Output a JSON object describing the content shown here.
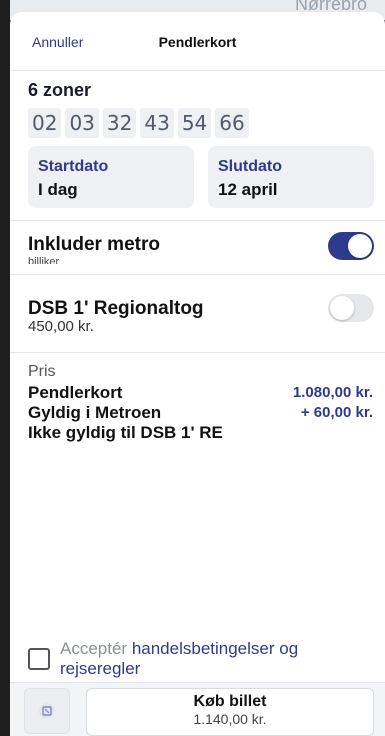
{
  "background": {
    "peek_text": "Nørrebro"
  },
  "header": {
    "cancel_label": "Annuller",
    "title": "Pendlerkort"
  },
  "zones": {
    "label": "6 zoner",
    "list": [
      "02",
      "03",
      "32",
      "43",
      "54",
      "66"
    ]
  },
  "dates": {
    "start_label": "Startdato",
    "start_value": "I dag",
    "end_label": "Slutdato",
    "end_value": "12 april"
  },
  "metro": {
    "label": "Inkluder metro",
    "sub": "billiker",
    "enabled": true
  },
  "dsb": {
    "label": "DSB 1' Regionaltog",
    "price": "450,00 kr.",
    "enabled": false
  },
  "pricing": {
    "title": "Pris",
    "rows": [
      {
        "label": "Pendlerkort",
        "amount": "1.080,00 kr."
      },
      {
        "label": "Gyldig i Metroen",
        "amount": "+ 60,00 kr."
      },
      {
        "label": "Ikke gyldig til DSB 1' RE",
        "amount": ""
      }
    ]
  },
  "terms": {
    "prefix": "Acceptér ",
    "link": "handelsbetingelser og rejseregler"
  },
  "buy": {
    "label": "Køb billet",
    "total": "1.140,00 kr."
  },
  "colors": {
    "accent": "#2e3a8c",
    "chip_bg": "#eef0f3",
    "card_bg": "#eef0f4"
  }
}
